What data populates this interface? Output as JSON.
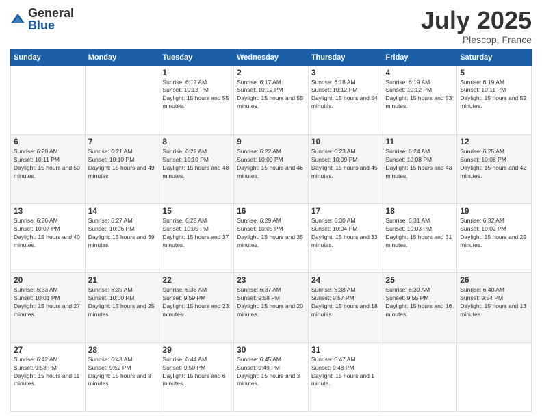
{
  "header": {
    "logo": {
      "general": "General",
      "blue": "Blue"
    },
    "title": "July 2025",
    "location": "Plescop, France"
  },
  "weekdays": [
    "Sunday",
    "Monday",
    "Tuesday",
    "Wednesday",
    "Thursday",
    "Friday",
    "Saturday"
  ],
  "weeks": [
    [
      {
        "day": "",
        "info": ""
      },
      {
        "day": "",
        "info": ""
      },
      {
        "day": "1",
        "info": "Sunrise: 6:17 AM\nSunset: 10:13 PM\nDaylight: 15 hours and 55 minutes."
      },
      {
        "day": "2",
        "info": "Sunrise: 6:17 AM\nSunset: 10:12 PM\nDaylight: 15 hours and 55 minutes."
      },
      {
        "day": "3",
        "info": "Sunrise: 6:18 AM\nSunset: 10:12 PM\nDaylight: 15 hours and 54 minutes."
      },
      {
        "day": "4",
        "info": "Sunrise: 6:19 AM\nSunset: 10:12 PM\nDaylight: 15 hours and 53 minutes."
      },
      {
        "day": "5",
        "info": "Sunrise: 6:19 AM\nSunset: 10:11 PM\nDaylight: 15 hours and 52 minutes."
      }
    ],
    [
      {
        "day": "6",
        "info": "Sunrise: 6:20 AM\nSunset: 10:11 PM\nDaylight: 15 hours and 50 minutes."
      },
      {
        "day": "7",
        "info": "Sunrise: 6:21 AM\nSunset: 10:10 PM\nDaylight: 15 hours and 49 minutes."
      },
      {
        "day": "8",
        "info": "Sunrise: 6:22 AM\nSunset: 10:10 PM\nDaylight: 15 hours and 48 minutes."
      },
      {
        "day": "9",
        "info": "Sunrise: 6:22 AM\nSunset: 10:09 PM\nDaylight: 15 hours and 46 minutes."
      },
      {
        "day": "10",
        "info": "Sunrise: 6:23 AM\nSunset: 10:09 PM\nDaylight: 15 hours and 45 minutes."
      },
      {
        "day": "11",
        "info": "Sunrise: 6:24 AM\nSunset: 10:08 PM\nDaylight: 15 hours and 43 minutes."
      },
      {
        "day": "12",
        "info": "Sunrise: 6:25 AM\nSunset: 10:08 PM\nDaylight: 15 hours and 42 minutes."
      }
    ],
    [
      {
        "day": "13",
        "info": "Sunrise: 6:26 AM\nSunset: 10:07 PM\nDaylight: 15 hours and 40 minutes."
      },
      {
        "day": "14",
        "info": "Sunrise: 6:27 AM\nSunset: 10:06 PM\nDaylight: 15 hours and 39 minutes."
      },
      {
        "day": "15",
        "info": "Sunrise: 6:28 AM\nSunset: 10:05 PM\nDaylight: 15 hours and 37 minutes."
      },
      {
        "day": "16",
        "info": "Sunrise: 6:29 AM\nSunset: 10:05 PM\nDaylight: 15 hours and 35 minutes."
      },
      {
        "day": "17",
        "info": "Sunrise: 6:30 AM\nSunset: 10:04 PM\nDaylight: 15 hours and 33 minutes."
      },
      {
        "day": "18",
        "info": "Sunrise: 6:31 AM\nSunset: 10:03 PM\nDaylight: 15 hours and 31 minutes."
      },
      {
        "day": "19",
        "info": "Sunrise: 6:32 AM\nSunset: 10:02 PM\nDaylight: 15 hours and 29 minutes."
      }
    ],
    [
      {
        "day": "20",
        "info": "Sunrise: 6:33 AM\nSunset: 10:01 PM\nDaylight: 15 hours and 27 minutes."
      },
      {
        "day": "21",
        "info": "Sunrise: 6:35 AM\nSunset: 10:00 PM\nDaylight: 15 hours and 25 minutes."
      },
      {
        "day": "22",
        "info": "Sunrise: 6:36 AM\nSunset: 9:59 PM\nDaylight: 15 hours and 23 minutes."
      },
      {
        "day": "23",
        "info": "Sunrise: 6:37 AM\nSunset: 9:58 PM\nDaylight: 15 hours and 20 minutes."
      },
      {
        "day": "24",
        "info": "Sunrise: 6:38 AM\nSunset: 9:57 PM\nDaylight: 15 hours and 18 minutes."
      },
      {
        "day": "25",
        "info": "Sunrise: 6:39 AM\nSunset: 9:55 PM\nDaylight: 15 hours and 16 minutes."
      },
      {
        "day": "26",
        "info": "Sunrise: 6:40 AM\nSunset: 9:54 PM\nDaylight: 15 hours and 13 minutes."
      }
    ],
    [
      {
        "day": "27",
        "info": "Sunrise: 6:42 AM\nSunset: 9:53 PM\nDaylight: 15 hours and 11 minutes."
      },
      {
        "day": "28",
        "info": "Sunrise: 6:43 AM\nSunset: 9:52 PM\nDaylight: 15 hours and 8 minutes."
      },
      {
        "day": "29",
        "info": "Sunrise: 6:44 AM\nSunset: 9:50 PM\nDaylight: 15 hours and 6 minutes."
      },
      {
        "day": "30",
        "info": "Sunrise: 6:45 AM\nSunset: 9:49 PM\nDaylight: 15 hours and 3 minutes."
      },
      {
        "day": "31",
        "info": "Sunrise: 6:47 AM\nSunset: 9:48 PM\nDaylight: 15 hours and 1 minute."
      },
      {
        "day": "",
        "info": ""
      },
      {
        "day": "",
        "info": ""
      }
    ]
  ]
}
